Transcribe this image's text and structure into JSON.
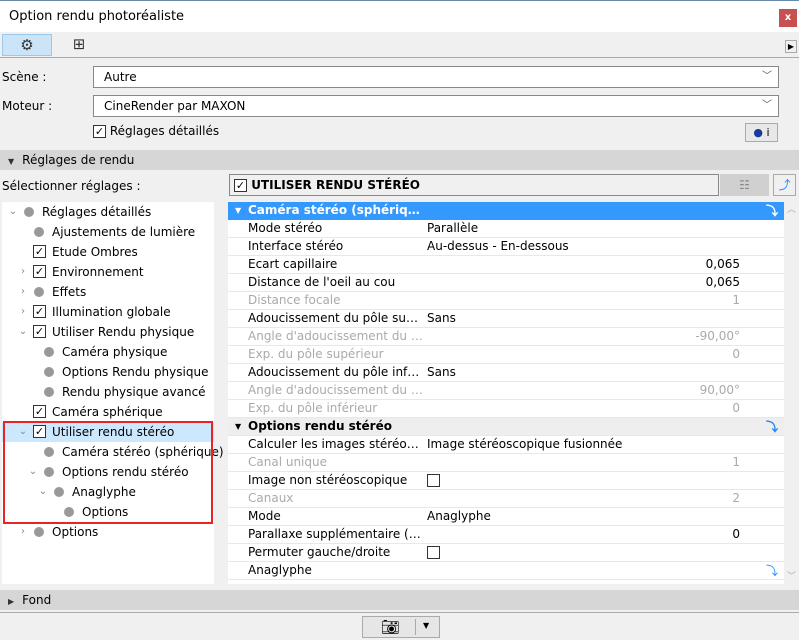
{
  "window": {
    "title": "Option rendu photoréaliste",
    "close": "x"
  },
  "toolbar": {
    "tabs": [
      {
        "icon": "gear-icon",
        "selected": true
      },
      {
        "icon": "crosshair-frame-icon",
        "selected": false
      }
    ],
    "expand": "▶"
  },
  "scene": {
    "label": "Scène :",
    "value": "Autre"
  },
  "engine": {
    "label": "Moteur :",
    "value": "CineRender par MAXON"
  },
  "detailed": {
    "label": "Réglages détaillés",
    "checked": true
  },
  "render_section": {
    "label": "Réglages de rendu"
  },
  "select_label": "Sélectionner réglages :",
  "stereo_toggle": {
    "label": "UTILISER RENDU STÉRÉO",
    "checked": true
  },
  "tree": [
    {
      "label": "Réglages détaillés",
      "level": 0,
      "arrow": "⌄",
      "mark": "dot"
    },
    {
      "label": "Ajustements de lumière",
      "level": 1,
      "arrow": "",
      "mark": "dot"
    },
    {
      "label": "Etude Ombres",
      "level": 1,
      "arrow": "",
      "mark": "check"
    },
    {
      "label": "Environnement",
      "level": 1,
      "arrow": "›",
      "mark": "check"
    },
    {
      "label": "Effets",
      "level": 1,
      "arrow": "›",
      "mark": "dot"
    },
    {
      "label": "Illumination globale",
      "level": 1,
      "arrow": "›",
      "mark": "check"
    },
    {
      "label": "Utiliser Rendu physique",
      "level": 1,
      "arrow": "⌄",
      "mark": "check"
    },
    {
      "label": "Caméra physique",
      "level": 2,
      "arrow": "",
      "mark": "dot"
    },
    {
      "label": "Options Rendu physique",
      "level": 2,
      "arrow": "",
      "mark": "dot"
    },
    {
      "label": "Rendu physique avancé",
      "level": 2,
      "arrow": "",
      "mark": "dot"
    },
    {
      "label": "Caméra sphérique",
      "level": 1,
      "arrow": "",
      "mark": "check"
    },
    {
      "label": "Utiliser rendu stéréo",
      "level": 1,
      "arrow": "⌄",
      "mark": "check",
      "selected": true
    },
    {
      "label": "Caméra stéréo (sphérique)",
      "level": 2,
      "arrow": "",
      "mark": "dot"
    },
    {
      "label": "Options rendu stéréo",
      "level": 2,
      "arrow": "⌄",
      "mark": "dot"
    },
    {
      "label": "Anaglyphe",
      "level": 3,
      "arrow": "⌄",
      "mark": "dot"
    },
    {
      "label": "Options",
      "level": 4,
      "arrow": "",
      "mark": "dot"
    },
    {
      "label": "Options",
      "level": 1,
      "arrow": "›",
      "mark": "dot"
    }
  ],
  "grid": [
    {
      "type": "header",
      "label": "Caméra stéréo (sphérique)",
      "style": "blue"
    },
    {
      "label": "Mode stéréo",
      "value": "Parallèle"
    },
    {
      "label": "Interface stéréo",
      "value": "Au-dessus - En-dessous"
    },
    {
      "label": "Ecart capillaire",
      "number": "0,065"
    },
    {
      "label": "Distance de l'oeil au cou",
      "number": "0,065"
    },
    {
      "label": "Distance focale",
      "number": "1",
      "disabled": true
    },
    {
      "label": "Adoucissement du pôle supérieur",
      "value": "Sans"
    },
    {
      "label": "Angle d'adoucissement du pôle supérieur",
      "number": "-90,00°",
      "disabled": true
    },
    {
      "label": "Exp. du pôle supérieur",
      "number": "0",
      "disabled": true
    },
    {
      "label": "Adoucissement du pôle inférieur",
      "value": "Sans"
    },
    {
      "label": "Angle d'adoucissement du pôle inférieur",
      "number": "90,00°",
      "disabled": true
    },
    {
      "label": "Exp. du pôle inférieur",
      "number": "0",
      "disabled": true
    },
    {
      "type": "header",
      "label": "Options rendu stéréo",
      "style": "gray"
    },
    {
      "label": "Calculer les images stéréoscopiques",
      "value": "Image stéréoscopique fusionnée"
    },
    {
      "label": "Canal unique",
      "number": "1",
      "disabled": true
    },
    {
      "label": "Image non stéréoscopique",
      "checkbox": false
    },
    {
      "label": "Canaux",
      "number": "2",
      "disabled": true
    },
    {
      "label": "Mode",
      "value": "Anaglyphe"
    },
    {
      "label": "Parallaxe supplémentaire (pixel)",
      "number": "0"
    },
    {
      "label": "Permuter gauche/droite",
      "checkbox": false
    },
    {
      "label": "Anaglyphe",
      "link": true
    }
  ],
  "background_section": {
    "label": "Fond"
  },
  "colors": {
    "accent": "#3399ff",
    "selection": "#cce8ff",
    "highlight_box": "#e82525",
    "close": "#c75050"
  }
}
